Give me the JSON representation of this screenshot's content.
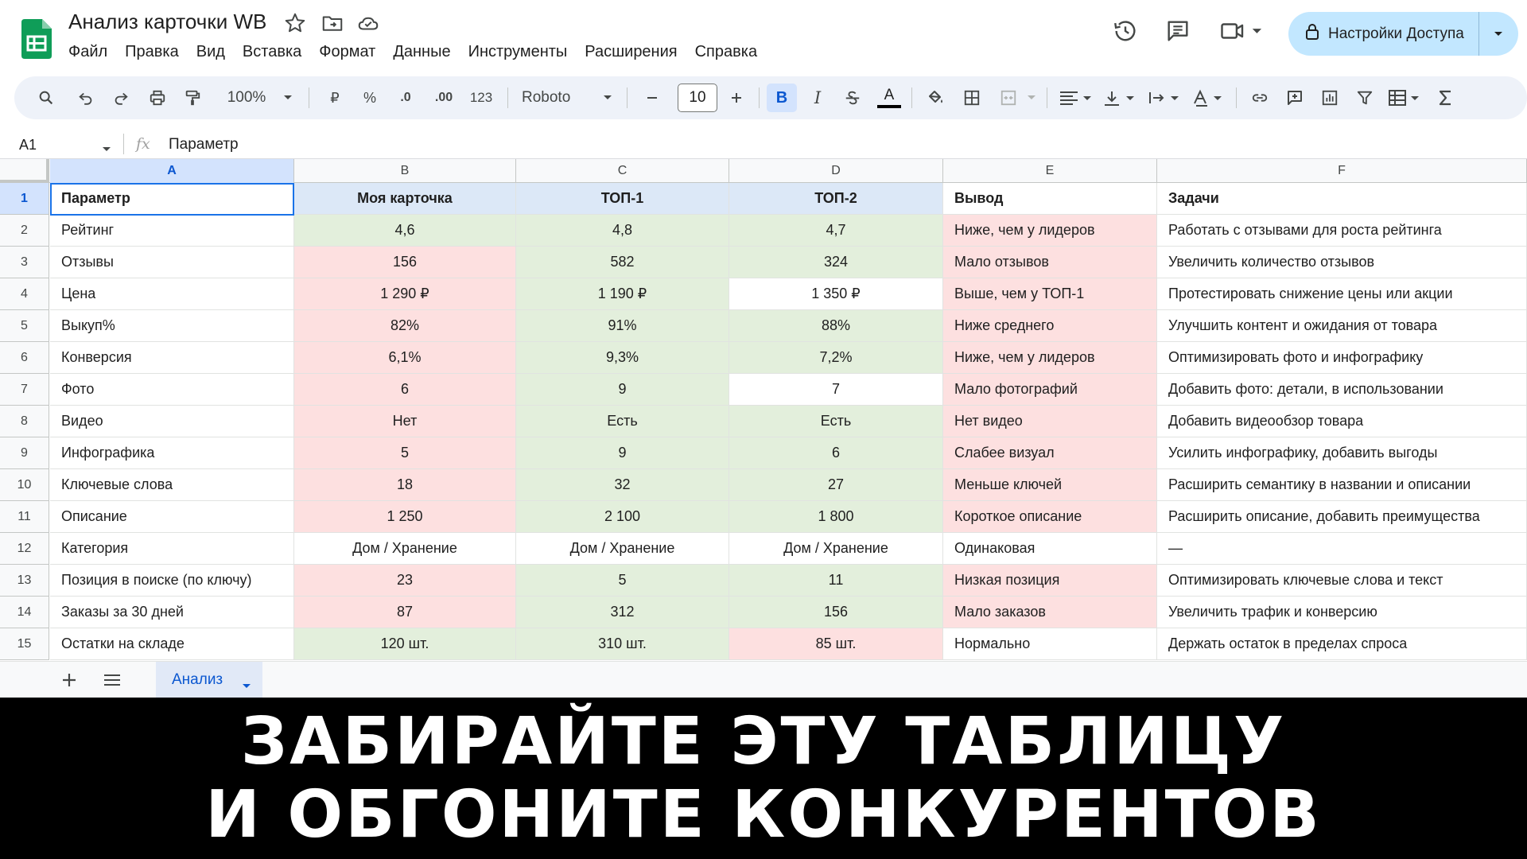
{
  "doc": {
    "title": "Анализ карточки WB"
  },
  "menu": [
    "Файл",
    "Правка",
    "Вид",
    "Вставка",
    "Формат",
    "Данные",
    "Инструменты",
    "Расширения",
    "Справка"
  ],
  "share": {
    "label": "Настройки Доступа"
  },
  "toolbar": {
    "zoom": "100%",
    "currency": "₽",
    "percent": "%",
    "dec_decrease": ".0",
    "dec_increase": ".00",
    "number_format": "123",
    "font": "Roboto",
    "font_size": "10",
    "bold": "B",
    "italic": "I",
    "text_color": "A"
  },
  "formula_bar": {
    "cell_ref": "A1",
    "fx": "fx",
    "value": "Параметр"
  },
  "columns": [
    "A",
    "B",
    "C",
    "D",
    "E",
    "F"
  ],
  "header_row": [
    "Параметр",
    "Моя карточка",
    "ТОП-1",
    "ТОП-2",
    "Вывод",
    "Задачи"
  ],
  "rows": [
    {
      "num": "2",
      "cells": [
        "Рейтинг",
        "4,6",
        "4,8",
        "4,7",
        "Ниже, чем у лидеров",
        "Работать с отзывами для роста рейтинга"
      ],
      "fill": [
        "white",
        "green",
        "green",
        "green",
        "red",
        "white"
      ]
    },
    {
      "num": "3",
      "cells": [
        "Отзывы",
        "156",
        "582",
        "324",
        "Мало отзывов",
        "Увеличить количество отзывов"
      ],
      "fill": [
        "white",
        "red",
        "green",
        "green",
        "red",
        "white"
      ]
    },
    {
      "num": "4",
      "cells": [
        "Цена",
        "1 290 ₽",
        "1 190 ₽",
        "1 350 ₽",
        "Выше, чем у ТОП-1",
        "Протестировать снижение цены или акции"
      ],
      "fill": [
        "white",
        "red",
        "green",
        "white",
        "red",
        "white"
      ]
    },
    {
      "num": "5",
      "cells": [
        "Выкуп%",
        "82%",
        "91%",
        "88%",
        "Ниже среднего",
        "Улучшить контент и ожидания от товара"
      ],
      "fill": [
        "white",
        "red",
        "green",
        "green",
        "red",
        "white"
      ]
    },
    {
      "num": "6",
      "cells": [
        "Конверсия",
        "6,1%",
        "9,3%",
        "7,2%",
        "Ниже, чем у лидеров",
        "Оптимизировать фото и инфографику"
      ],
      "fill": [
        "white",
        "red",
        "green",
        "green",
        "red",
        "white"
      ]
    },
    {
      "num": "7",
      "cells": [
        "Фото",
        "6",
        "9",
        "7",
        "Мало фотографий",
        "Добавить фото: детали, в использовании"
      ],
      "fill": [
        "white",
        "red",
        "green",
        "white",
        "red",
        "white"
      ]
    },
    {
      "num": "8",
      "cells": [
        "Видео",
        "Нет",
        "Есть",
        "Есть",
        "Нет видео",
        "Добавить видеообзор товара"
      ],
      "fill": [
        "white",
        "red",
        "green",
        "green",
        "red",
        "white"
      ]
    },
    {
      "num": "9",
      "cells": [
        "Инфографика",
        "5",
        "9",
        "6",
        "Слабее визуал",
        "Усилить инфографику, добавить выгоды"
      ],
      "fill": [
        "white",
        "red",
        "green",
        "green",
        "red",
        "white"
      ]
    },
    {
      "num": "10",
      "cells": [
        "Ключевые слова",
        "18",
        "32",
        "27",
        "Меньше ключей",
        "Расширить семантику в названии и описании"
      ],
      "fill": [
        "white",
        "red",
        "green",
        "green",
        "red",
        "white"
      ]
    },
    {
      "num": "11",
      "cells": [
        "Описание",
        "1 250",
        "2 100",
        "1 800",
        "Короткое описание",
        "Расширить описание, добавить преимущества"
      ],
      "fill": [
        "white",
        "red",
        "green",
        "green",
        "red",
        "white"
      ]
    },
    {
      "num": "12",
      "cells": [
        "Категория",
        "Дом / Хранение",
        "Дом / Хранение",
        "Дом / Хранение",
        "Одинаковая",
        "—"
      ],
      "fill": [
        "white",
        "white",
        "white",
        "white",
        "white",
        "white"
      ]
    },
    {
      "num": "13",
      "cells": [
        "Позиция в поиске (по ключу)",
        "23",
        "5",
        "11",
        "Низкая позиция",
        "Оптимизировать ключевые слова и текст"
      ],
      "fill": [
        "white",
        "red",
        "green",
        "green",
        "red",
        "white"
      ]
    },
    {
      "num": "14",
      "cells": [
        "Заказы за 30 дней",
        "87",
        "312",
        "156",
        "Мало заказов",
        "Увеличить трафик и конверсию"
      ],
      "fill": [
        "white",
        "red",
        "green",
        "green",
        "red",
        "white"
      ]
    },
    {
      "num": "15",
      "cells": [
        "Остатки на складе",
        "120 шт.",
        "310 шт.",
        "85 шт.",
        "Нормально",
        "Держать остаток в пределах спроса"
      ],
      "fill": [
        "white",
        "green",
        "green",
        "red",
        "white",
        "white"
      ]
    }
  ],
  "sheet": {
    "tab_label": "Анализ"
  },
  "caption": {
    "line1": "ЗАБИРАЙТЕ ЭТУ ТАБЛИЦУ",
    "line2": "И ОБГОНИТЕ КОНКУРЕНТОВ"
  },
  "colors": {
    "red_fill": "#fde0e0",
    "green_fill": "#e3efdc",
    "header_fill": "#dce8f7",
    "accent": "#0b57d0",
    "sheets_green": "#0f9d58"
  }
}
